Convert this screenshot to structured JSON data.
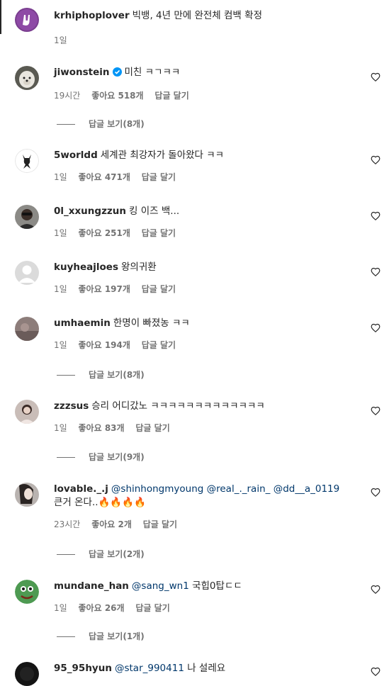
{
  "caption": {
    "username": "krhiphoplover",
    "text": "빅뱅, 4년 만에 완전체 컴백 확정",
    "time": "1일"
  },
  "comments": [
    {
      "username": "jiwonstein",
      "verified": true,
      "text": "미친 ㅋㄱㅋㅋ",
      "time": "19시간",
      "likes": "좋아요 518개",
      "reply": "답글 달기",
      "view_replies": "답글 보기(8개)"
    },
    {
      "username": "5worldd",
      "text": "세계관 최강자가 돌아왔다 ㅋㅋ",
      "time": "1일",
      "likes": "좋아요 471개",
      "reply": "답글 달기"
    },
    {
      "username": "0l_xxungzzun",
      "text": "킹 이즈 백...",
      "time": "1일",
      "likes": "좋아요 251개",
      "reply": "답글 달기"
    },
    {
      "username": "kuyheajloes",
      "text": "왕의귀환",
      "time": "1일",
      "likes": "좋아요 197개",
      "reply": "답글 달기"
    },
    {
      "username": "umhaemin",
      "text": "한명이 빠졌농 ㅋㅋ",
      "time": "1일",
      "likes": "좋아요 194개",
      "reply": "답글 달기",
      "view_replies": "답글 보기(8개)"
    },
    {
      "username": "zzzsus",
      "text": "승리 어디갔노 ㅋㅋㅋㅋㅋㅋㅋㅋㅋㅋㅋㅋㅋ",
      "time": "1일",
      "likes": "좋아요 83개",
      "reply": "답글 달기",
      "view_replies": "답글 보기(9개)"
    },
    {
      "username": "lovable._.j",
      "mentions": [
        "@shinhongmyoung",
        "@real_._rain_",
        "@dd__a_0119"
      ],
      "text": "큰거 온다..🔥🔥🔥🔥",
      "time": "23시간",
      "likes": "좋아요 2개",
      "reply": "답글 달기",
      "view_replies": "답글 보기(2개)"
    },
    {
      "username": "mundane_han",
      "mentions": [
        "@sang_wn1"
      ],
      "text": "국힙0탑ㄷㄷ",
      "time": "1일",
      "likes": "좋아요 26개",
      "reply": "답글 달기",
      "view_replies": "답글 보기(1개)"
    },
    {
      "username": "95_95hyun",
      "mentions": [
        "@star_990411"
      ],
      "text": "나 설레요"
    }
  ],
  "colors": {
    "text": "#262626",
    "secondary": "#737373",
    "mention": "#00376b",
    "verified": "#0095f6"
  },
  "icons": {
    "like": "heart-outline-icon",
    "verified": "verified-badge-icon"
  }
}
